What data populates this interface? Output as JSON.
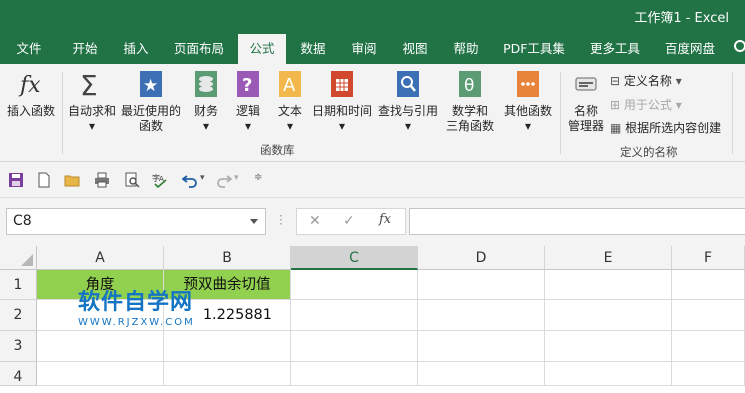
{
  "window": {
    "title": "工作簿1  -  Excel"
  },
  "tabs": [
    {
      "label": "文件"
    },
    {
      "label": "开始"
    },
    {
      "label": "插入"
    },
    {
      "label": "页面布局"
    },
    {
      "label": "公式",
      "active": true
    },
    {
      "label": "数据"
    },
    {
      "label": "审阅"
    },
    {
      "label": "视图"
    },
    {
      "label": "帮助"
    },
    {
      "label": "PDF工具集"
    },
    {
      "label": "更多工具"
    },
    {
      "label": "百度网盘"
    }
  ],
  "ribbon": {
    "insert_function": "插入函数",
    "autosum": "自动求和",
    "recent": {
      "line1": "最近使用的",
      "line2": "函数"
    },
    "financial": "财务",
    "logical": "逻辑",
    "text": "文本",
    "datetime": "日期和时间",
    "lookup": "查找与引用",
    "math": {
      "line1": "数学和",
      "line2": "三角函数"
    },
    "other": "其他函数",
    "library_group": "函数库",
    "name_manager": {
      "line1": "名称",
      "line2": "管理器"
    },
    "define_name": "定义名称",
    "use_in_formula": "用于公式",
    "create_from_selection": "根据所选内容创建",
    "names_group": "定义的名称",
    "icons": {
      "insert_function": "fx-icon",
      "autosum": "sigma-icon",
      "recent": "star-book-icon",
      "financial": "coins-book-icon",
      "logical": "question-book-icon",
      "text": "letter-a-book-icon",
      "datetime": "calendar-book-icon",
      "lookup": "magnifier-book-icon",
      "math": "theta-book-icon",
      "other": "more-book-icon"
    }
  },
  "formula_bar": {
    "name_box": "C8",
    "fx": "fx",
    "cancel": "✕",
    "enter": "✓"
  },
  "grid": {
    "columns": [
      "A",
      "B",
      "C",
      "D",
      "E",
      "F"
    ],
    "rows": [
      "1",
      "2",
      "3",
      "4"
    ],
    "selected_column": "C",
    "A1": "角度",
    "B1": "预双曲余切值",
    "B2": "1.225881"
  },
  "watermark": {
    "main": "软件自学网",
    "sub": "WWW.RJZXW.COM"
  },
  "colors": {
    "excel_green": "#217346",
    "header_fill": "#92d050",
    "watermark": "#1474c4"
  }
}
